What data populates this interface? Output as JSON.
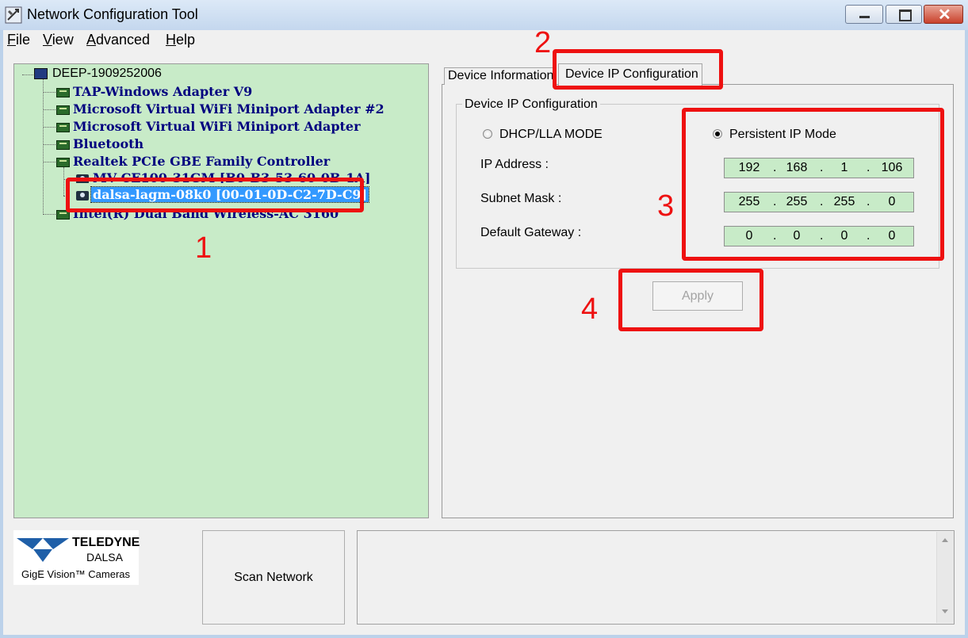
{
  "window": {
    "title": "Network Configuration Tool"
  },
  "menu": {
    "file": {
      "accel": "F",
      "rest": "ile"
    },
    "view": {
      "accel": "V",
      "rest": "iew"
    },
    "advanced": {
      "accel": "A",
      "rest": "dvanced"
    },
    "help": {
      "accel": "H",
      "rest": "elp"
    }
  },
  "tree": {
    "root": "DEEP-1909252006",
    "adapters": [
      "TAP-Windows Adapter V9",
      "Microsoft Virtual WiFi Miniport Adapter #2",
      "Microsoft Virtual WiFi Miniport Adapter",
      "Bluetooth",
      "Realtek PCIe GBE Family Controller",
      "Intel(R) Dual Band Wireless-AC 3160"
    ],
    "devices": [
      "MV-CE100-31GM [B0-B3-53-60-0B-1A]",
      "dalsa-lagm-08k0 [00-01-0D-C2-7D-C9]"
    ],
    "selected_device_index": 1
  },
  "tabs": {
    "device_info": "Device Information",
    "device_ip": "Device IP Configuration",
    "active": "device_ip"
  },
  "ip_config": {
    "group_title": "Device IP Configuration",
    "dhcp_label": "DHCP/LLA MODE",
    "persistent_label": "Persistent IP Mode",
    "selected_mode": "persistent",
    "ip_label": "IP Address :",
    "mask_label": "Subnet Mask :",
    "gateway_label": "Default Gateway :",
    "ip": [
      "192",
      "168",
      "1",
      "106"
    ],
    "mask": [
      "255",
      "255",
      "255",
      "0"
    ],
    "gateway": [
      "0",
      "0",
      "0",
      "0"
    ],
    "dot": "."
  },
  "apply_label": "Apply",
  "apply_enabled": false,
  "scan_label": "Scan Network",
  "logo": {
    "brand": "TELEDYNE",
    "sub": "DALSA",
    "product": "GigE Vision™ Cameras",
    "color": "#1f5fa8"
  },
  "annotations": {
    "n1": "1",
    "n2": "2",
    "n3": "3",
    "n4": "4",
    "color": "#ee1111"
  },
  "colors": {
    "tree_bg": "#c8ebc8",
    "node_text": "#00007f",
    "selection": "#3399ff"
  }
}
